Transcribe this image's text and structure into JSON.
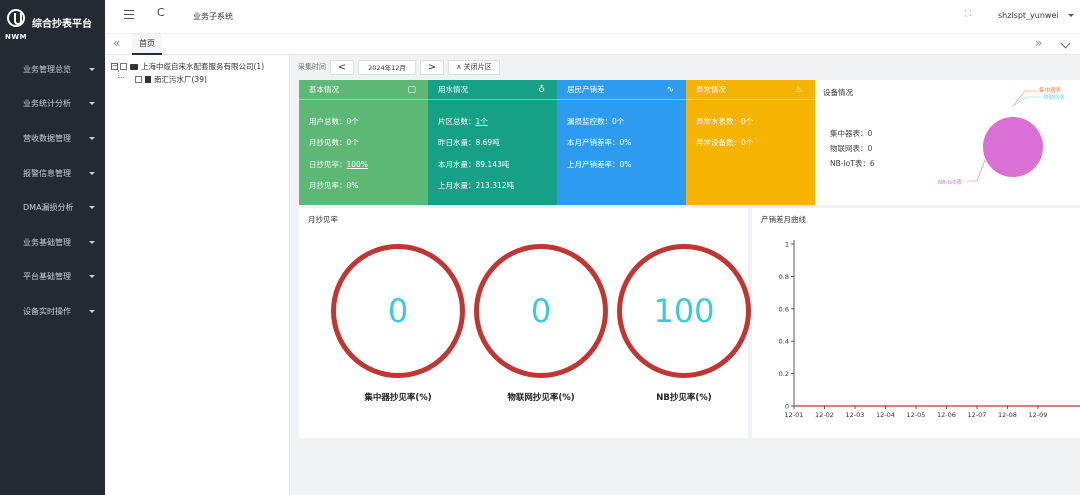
{
  "app": {
    "title": "综合抄表平台",
    "logo_text": "NWM"
  },
  "sidebar": {
    "items": [
      {
        "label": "业务管理总览"
      },
      {
        "label": "业务统计分析"
      },
      {
        "label": "营收数据管理"
      },
      {
        "label": "报警信息管理"
      },
      {
        "label": "DMA漏损分析"
      },
      {
        "label": "业务基础管理"
      },
      {
        "label": "平台基础管理"
      },
      {
        "label": "设备实时操作"
      }
    ]
  },
  "header": {
    "subsystem": "业务子系统",
    "user": "shzlspt_yunwei"
  },
  "tabs": {
    "prev_glyph": "«",
    "home": "首页",
    "next_glyph": "»"
  },
  "tree": {
    "root": "上海中缆自来水配套服务有限公司(1)",
    "child": "南汇污水厂(39)"
  },
  "filter": {
    "label": "采集时间",
    "prev": "<",
    "date": "2024年12月",
    "next": ">",
    "area_toggle": "∧ 关闭片区"
  },
  "cards": {
    "basic": {
      "title": "基本情况",
      "color": "#5cb874",
      "lines": [
        "用户总数：0个",
        "月抄见数：0个",
        "日抄见率：",
        "月抄见率：0%"
      ],
      "day_rate": "100%"
    },
    "water": {
      "title": "用水情况",
      "color": "#16a085",
      "lines": [
        "片区总数：",
        "昨日水量：8.69吨",
        "本月水量：89.143吨",
        "上月水量：213.312吨"
      ],
      "area_count": "1个"
    },
    "resident": {
      "title": "居民产销差",
      "color": "#2d9cf0",
      "lines": [
        "漏损监控数：0个",
        "本月产销差率：0%",
        "上月产销差率：0%"
      ]
    },
    "abnormal": {
      "title": "异常情况",
      "color": "#f5b400",
      "lines": [
        "异常水表数：0个",
        "异常设备数：0个"
      ]
    }
  },
  "device": {
    "title": "设备情况",
    "lines": [
      "集中器表：0",
      "物联网表：0",
      "NB-IoT表：6"
    ],
    "pie_legend": [
      "集中器表",
      "物联网表",
      "NB-IoT表"
    ],
    "pie_values": [
      0,
      0,
      6
    ],
    "pie_colors": [
      "#ff7f50",
      "#87cefa",
      "#da70d6"
    ]
  },
  "rate": {
    "title": "月抄见率",
    "gauges": [
      {
        "value": "0",
        "label": "集中器抄见率(%)"
      },
      {
        "value": "0",
        "label": "物联网抄见率(%)"
      },
      {
        "value": "100",
        "label": "NB抄见率(%)"
      }
    ],
    "ring_color": "#c23531",
    "value_color": "#3ccad7"
  },
  "curve": {
    "title": "产销差月曲线",
    "chart_data": {
      "type": "line",
      "categories": [
        "12-01",
        "12-02",
        "12-03",
        "12-04",
        "12-05",
        "12-06",
        "12-07",
        "12-08",
        "12-09"
      ],
      "ytick_labels": [
        "0",
        "0.2",
        "0.4",
        "0.6",
        "0.8",
        "1"
      ],
      "ylim": [
        0,
        1
      ],
      "series": [
        {
          "values": [
            0,
            0,
            0,
            0,
            0,
            0,
            0,
            0,
            0
          ]
        }
      ],
      "line_color": "#c23531"
    }
  }
}
